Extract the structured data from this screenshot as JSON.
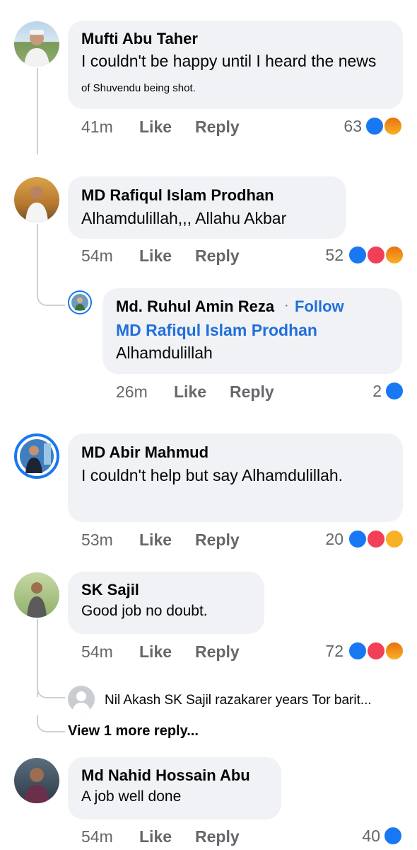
{
  "comments": [
    {
      "author": "Mufti Abu Taher",
      "text": "I couldn't be happy until I heard the news",
      "text2": "of Shuvendu being shot.",
      "time": "41m",
      "like": "Like",
      "reply": "Reply",
      "count": "63",
      "reactions": [
        "like",
        "angry"
      ]
    },
    {
      "author": "MD Rafiqul Islam Prodhan",
      "text": "Alhamdulillah,,, Allahu Akbar",
      "time": "54m",
      "like": "Like",
      "reply": "Reply",
      "count": "52",
      "reactions": [
        "like",
        "love",
        "angry"
      ]
    },
    {
      "author": "MD Abir Mahmud",
      "text": "I couldn't help but say Alhamdulillah.",
      "time": "53m",
      "like": "Like",
      "reply": "Reply",
      "count": "20",
      "reactions": [
        "like",
        "love",
        "haha"
      ]
    },
    {
      "author": "SK Sajil",
      "text": "Good job no doubt.",
      "time": "54m",
      "like": "Like",
      "reply": "Reply",
      "count": "72",
      "reactions": [
        "like",
        "love",
        "angry"
      ]
    },
    {
      "author": "Md Nahid Hossain Abu",
      "text": "A job well done",
      "time": "54m",
      "like": "Like",
      "reply": "Reply",
      "count": "40",
      "reactions": [
        "like"
      ]
    }
  ],
  "reply1": {
    "author": "Md. Ruhul Amin Reza",
    "separator": "·",
    "follow": "Follow",
    "mention": "MD Rafiqul Islam Prodhan",
    "text": "Alhamdulillah",
    "time": "26m",
    "like": "Like",
    "reply": "Reply",
    "count": "2",
    "reactions": [
      "like"
    ]
  },
  "reply_preview": {
    "text": "Nil Akash SK Sajil razakarer years Tor barit..."
  },
  "view_more": "View 1 more reply...",
  "colors": {
    "bubble": "#f0f2f5",
    "meta": "#65676b",
    "link": "#216fdb",
    "like": "#1877f2",
    "love": "#f33e58",
    "angry": "#e9710f",
    "haha": "#f7b125"
  }
}
